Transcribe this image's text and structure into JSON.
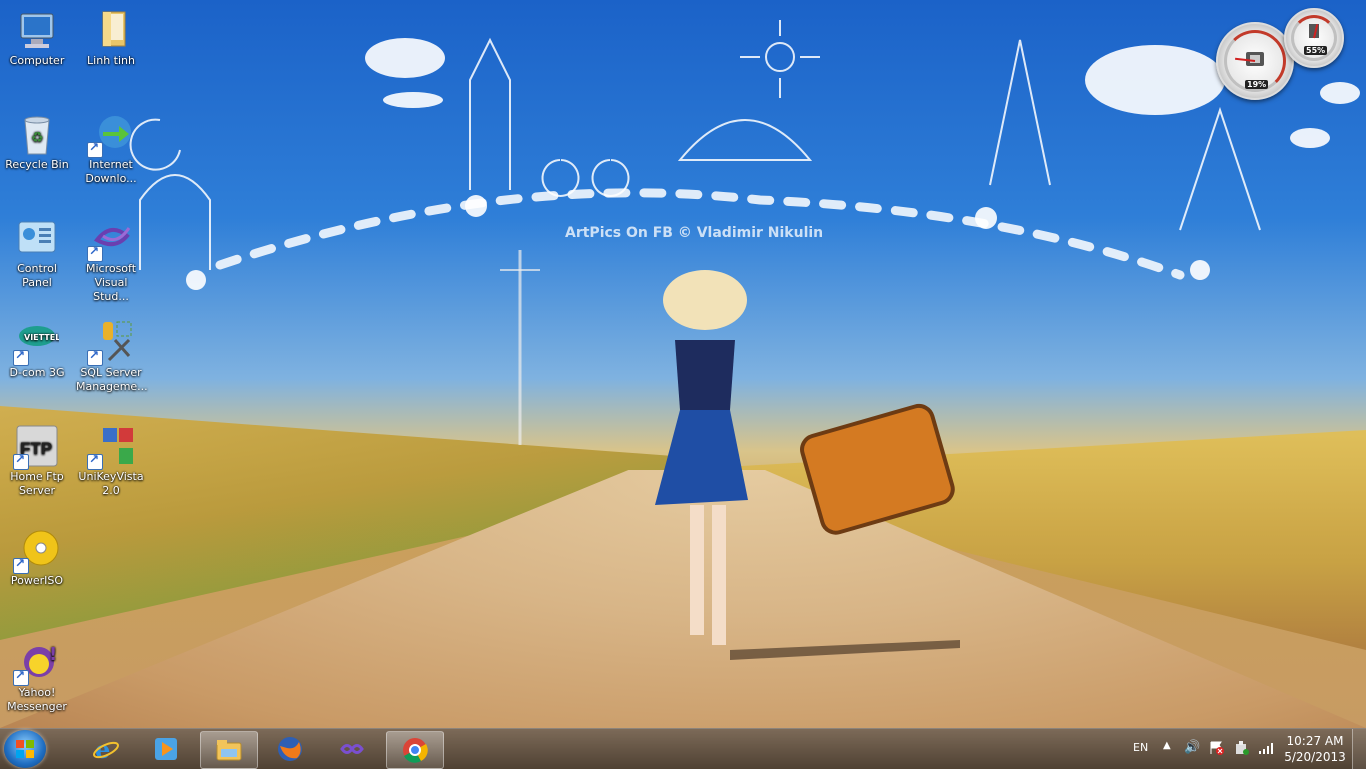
{
  "wallpaper": {
    "watermark": "ArtPics On FB © Vladimir Nikulin"
  },
  "desktop_icons": [
    {
      "label": "Computer",
      "icon": "computer-icon"
    },
    {
      "label": "Linh tinh",
      "icon": "folder-icon"
    },
    {
      "label": "Recycle Bin",
      "icon": "recycle-bin-icon"
    },
    {
      "label": "Internet Downlo...",
      "icon": "internet-download-manager-icon"
    },
    {
      "label": "Control Panel",
      "icon": "control-panel-icon"
    },
    {
      "label": "Microsoft Visual Stud...",
      "icon": "visual-studio-icon"
    },
    {
      "label": "D-com 3G",
      "icon": "dcom-3g-icon"
    },
    {
      "label": "SQL Server Manageme...",
      "icon": "sql-server-icon"
    },
    {
      "label": "Home Ftp Server",
      "icon": "ftp-icon"
    },
    {
      "label": "UniKeyVista 2.0",
      "icon": "unikey-icon"
    },
    {
      "label": "PowerISO",
      "icon": "poweriso-icon"
    },
    {
      "label": "Yahoo! Messenger",
      "icon": "yahoo-messenger-icon"
    }
  ],
  "gadget": {
    "cpu_label": "19%",
    "mem_label": "55%",
    "cpu_value": 19,
    "mem_value": 55
  },
  "taskbar": {
    "pinned": [
      {
        "name": "internet-explorer-icon",
        "active": false
      },
      {
        "name": "media-player-icon",
        "active": false
      },
      {
        "name": "file-explorer-icon",
        "active": true
      },
      {
        "name": "firefox-icon",
        "active": false
      },
      {
        "name": "visual-studio-taskbar-icon",
        "active": false
      },
      {
        "name": "chrome-icon",
        "active": true
      }
    ],
    "language": "EN",
    "time": "10:27 AM",
    "date": "5/20/2013"
  }
}
